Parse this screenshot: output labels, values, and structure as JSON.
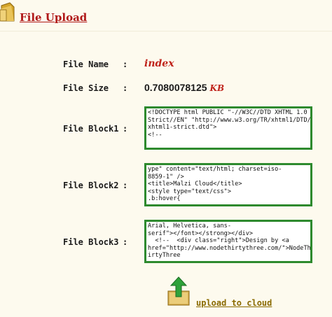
{
  "header": {
    "title": "File Upload",
    "icon": "folder-icon"
  },
  "fields": {
    "file_name": {
      "label": "File Name",
      "colon": ":",
      "value": "index"
    },
    "file_size": {
      "label": "File Size",
      "colon": ":",
      "value": "0.7080078125",
      "unit": "KB"
    },
    "block1": {
      "label": "File Block1",
      "colon": ":",
      "content": "<!DOCTYPE html PUBLIC \"-//W3C//DTD XHTML 1.0\nStrict//EN\" \"http://www.w3.org/TR/xhtml1/DTD/\nxhtml1-strict.dtd\">\n<!--"
    },
    "block2": {
      "label": "File Block2",
      "colon": ":",
      "content": "ype\" content=\"text/html; charset=iso-\n8859-1\" />\n<title>Malzi Cloud</title>\n<style type=\"text/css\">\n.b:hover{"
    },
    "block3": {
      "label": "File Block3",
      "colon": ":",
      "content": "Arial, Helvetica, sans-\nserif\"></font></strong></div>\n  <!--  <div class=\"right\">Design by <a\nhref=\"http://www.nodethirtythree.com/\">NodeTh\nirtyThree"
    }
  },
  "action": {
    "icon": "upload-arrow-icon",
    "label": "upload to cloud"
  },
  "colors": {
    "title": "#b01818",
    "accent_red": "#c0241c",
    "block_border": "#2e8a2e",
    "link": "#8a6a00",
    "background": "#fdfaee"
  }
}
